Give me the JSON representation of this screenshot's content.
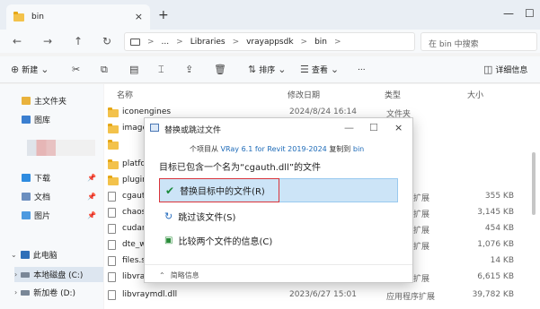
{
  "tab": {
    "title": "bin",
    "close": "×",
    "new_tab": "+"
  },
  "window_controls": {
    "minimize": "—",
    "maximize": "☐"
  },
  "nav": {
    "back": "←",
    "forward": "→",
    "up": "↑",
    "refresh": "↻"
  },
  "address": {
    "more": "...",
    "crumbs": [
      "Libraries",
      "vrayappsdk",
      "bin"
    ],
    "separator": ">"
  },
  "search": {
    "placeholder": "在 bin 中搜索"
  },
  "toolbar": {
    "new_label": "新建",
    "sort_label": "排序",
    "view_label": "查看",
    "more": "...",
    "details_label": "详细信息"
  },
  "sidebar": {
    "items": [
      {
        "label": "主文件夹",
        "icon": "home-icon"
      },
      {
        "label": "图库",
        "icon": "gallery-icon"
      },
      {
        "label": "下载",
        "icon": "download-icon"
      },
      {
        "label": "文档",
        "icon": "document-icon"
      },
      {
        "label": "图片",
        "icon": "pictures-icon"
      },
      {
        "label": "此电脑",
        "icon": "pc-icon"
      },
      {
        "label": "本地磁盘 (C:)",
        "icon": "drive-icon"
      },
      {
        "label": "新加卷 (D:)",
        "icon": "drive-icon"
      }
    ]
  },
  "columns": {
    "name": "名称",
    "date": "修改日期",
    "type": "类型",
    "size": "大小"
  },
  "rows": [
    {
      "name": "iconengines",
      "date": "2024/8/24 16:14",
      "type": "文件夹",
      "size": "",
      "kind": "folder"
    },
    {
      "name": "image",
      "date": "",
      "type": "",
      "size": "",
      "kind": "folder"
    },
    {
      "name": "",
      "date": "",
      "type": "",
      "size": "",
      "kind": "folder"
    },
    {
      "name": "platfo",
      "date": "",
      "type": "",
      "size": "",
      "kind": "folder"
    },
    {
      "name": "plugin",
      "date": "",
      "type": "",
      "size": "",
      "kind": "folder"
    },
    {
      "name": "cgaut",
      "date": "",
      "type": "扩展",
      "size": "355 KB",
      "kind": "file"
    },
    {
      "name": "chaos_",
      "date": "",
      "type": "扩展",
      "size": "3,145 KB",
      "kind": "file"
    },
    {
      "name": "cudart",
      "date": "",
      "type": "扩展",
      "size": "454 KB",
      "kind": "file"
    },
    {
      "name": "dte_w",
      "date": "",
      "type": "扩展",
      "size": "1,076 KB",
      "kind": "file"
    },
    {
      "name": "files.si",
      "date": "",
      "type": "",
      "size": "14 KB",
      "kind": "file"
    },
    {
      "name": "libvra",
      "date": "",
      "type": "扩展",
      "size": "6,615 KB",
      "kind": "file"
    },
    {
      "name": "libvraymdl.dll",
      "date": "2023/6/27 15:01",
      "type": "应用程序扩展",
      "size": "39,782 KB",
      "kind": "file"
    }
  ],
  "dialog": {
    "title": "替换或跳过文件",
    "line1_pre": "个项目从",
    "source": "VRay 6.1 for Revit 2019-2024",
    "line1_mid": "复制到",
    "dest": "bin",
    "line2": "目标已包含一个名为“cgauth.dll”的文件",
    "options": [
      {
        "label": "替换目标中的文件(R)",
        "icon": "check-icon"
      },
      {
        "label": "跳过该文件(S)",
        "icon": "skip-icon"
      },
      {
        "label": "比较两个文件的信息(C)",
        "icon": "compare-icon"
      }
    ],
    "details_label": "简略信息"
  },
  "colors": {
    "accent": "#1e6bb8",
    "selection": "#cce4f7",
    "highlight_box": "#d9333a"
  }
}
